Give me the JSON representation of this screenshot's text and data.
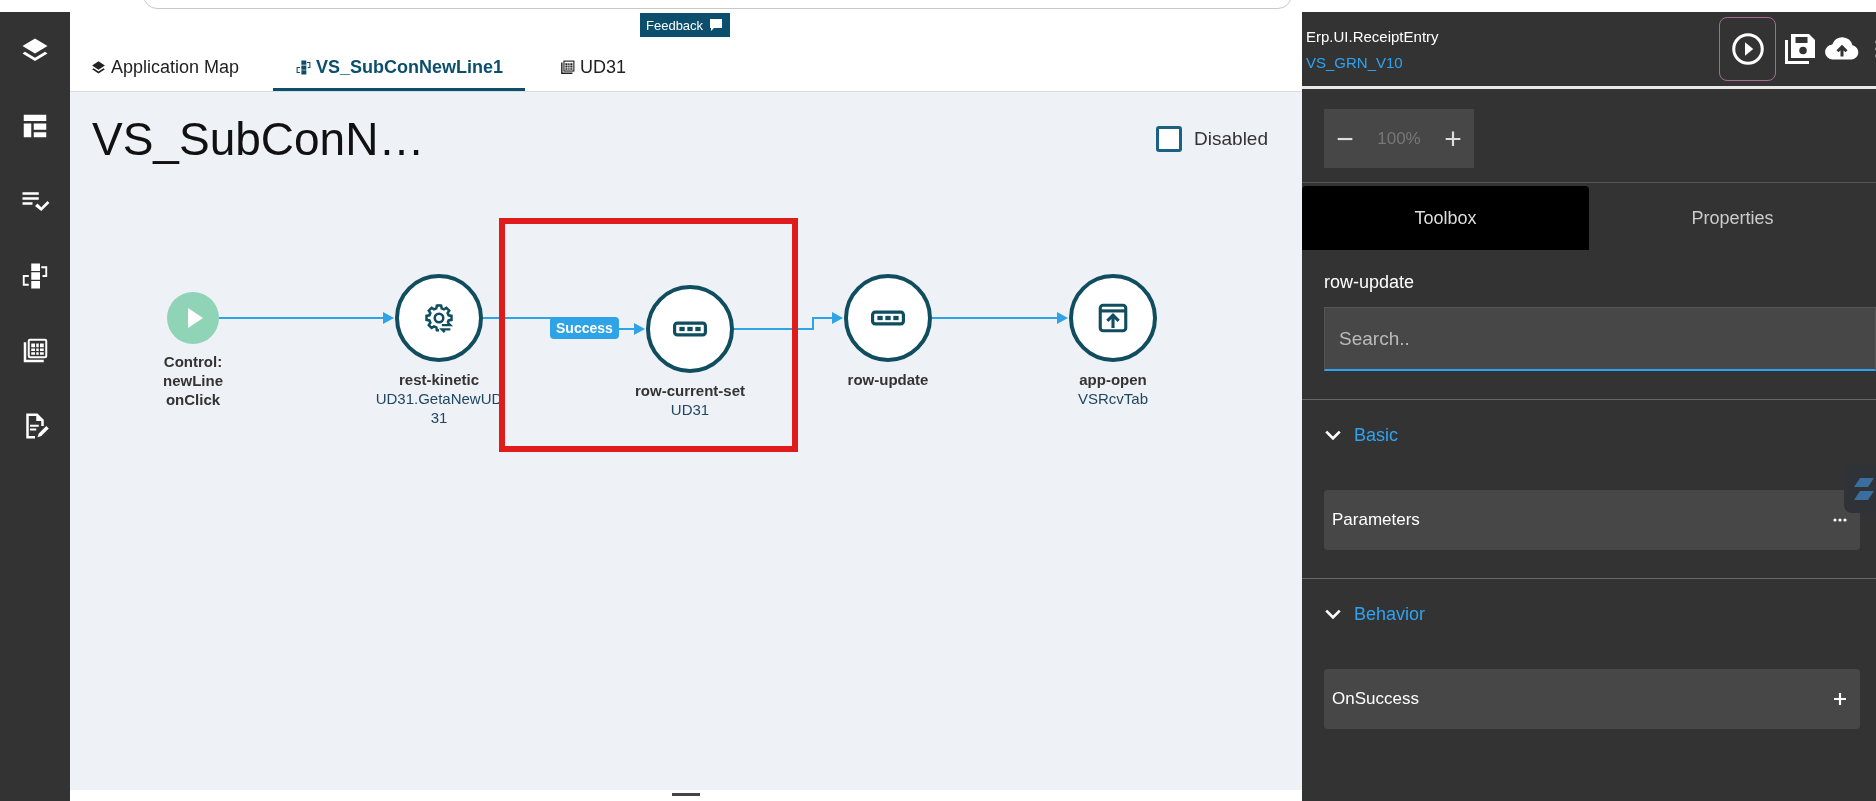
{
  "sidebar_items": [
    {
      "kind": "layers"
    },
    {
      "kind": "layout"
    },
    {
      "kind": "checklist"
    },
    {
      "kind": "flow"
    },
    {
      "kind": "grid"
    },
    {
      "kind": "edit"
    }
  ],
  "tabs": [
    {
      "label": "Application Map",
      "kind": "layers",
      "selected": false
    },
    {
      "label": "VS_SubConNewLine1",
      "kind": "flow",
      "selected": true
    },
    {
      "label": "UD31",
      "kind": "grid",
      "selected": false
    }
  ],
  "feedback": {
    "label": "Feedback"
  },
  "canvas": {
    "title": "VS_SubConN…",
    "disabled": {
      "label": "Disabled",
      "checked": false
    },
    "nodes": [
      {
        "kind": "start",
        "title": "Control: newLine onClick",
        "highlighted": false
      },
      {
        "kind": "gear",
        "title": "rest-kinetic",
        "subtitle": "UD31.GetaNewUD31",
        "highlighted": false
      },
      {
        "kind": "dots",
        "title": "row-current-set",
        "subtitle": "UD31",
        "incoming_label": "Success",
        "highlighted": true
      },
      {
        "kind": "dots",
        "title": "row-update",
        "highlighted": false
      },
      {
        "kind": "open",
        "title": "app-open",
        "subtitle": "VSRcvTab",
        "highlighted": false
      }
    ]
  },
  "panel": {
    "app_name": "Erp.UI.ReceiptEntry",
    "layer": "VS_GRN_V10",
    "zoom": {
      "minus": "−",
      "value": "100%",
      "plus": "+"
    },
    "tabs": [
      {
        "label": "Toolbox",
        "selected": true
      },
      {
        "label": "Properties",
        "selected": false
      }
    ],
    "heading": "row-update",
    "search": {
      "placeholder": "Search.."
    },
    "sections": [
      {
        "title": "Basic",
        "expanded": true,
        "rows": [
          {
            "label": "Parameters",
            "kind": "more"
          }
        ]
      },
      {
        "title": "Behavior",
        "expanded": true,
        "rows": [
          {
            "label": "OnSuccess",
            "kind": "add"
          }
        ]
      }
    ]
  }
}
